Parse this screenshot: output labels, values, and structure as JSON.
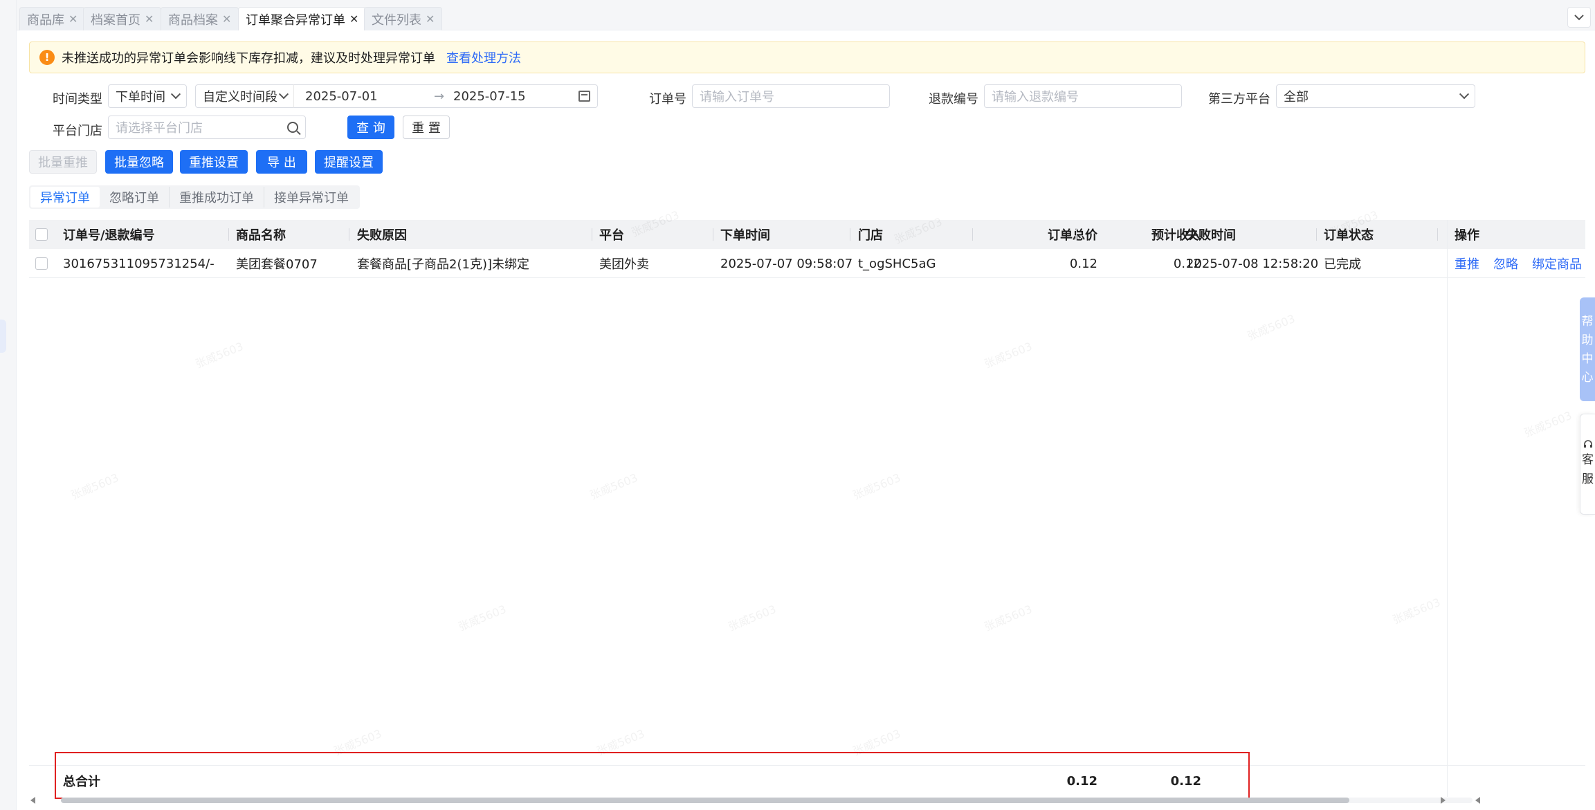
{
  "tabs": [
    {
      "label": "商品库",
      "active": false
    },
    {
      "label": "档案首页",
      "active": false
    },
    {
      "label": "商品档案",
      "active": false
    },
    {
      "label": "订单聚合异常订单",
      "active": true
    },
    {
      "label": "文件列表",
      "active": false
    }
  ],
  "tab_close_glyph": "✕",
  "alert": {
    "message": "未推送成功的异常订单会影响线下库存扣减，建议及时处理异常订单",
    "link": "查看处理方法",
    "icon": "warning-icon"
  },
  "filters": {
    "time_type_label": "时间类型",
    "time_type_value": "下单时间",
    "time_range_mode": "自定义时间段",
    "date_start": "2025-07-01",
    "date_arrow": "→",
    "date_end": "2025-07-15",
    "order_no_label": "订单号",
    "order_no_placeholder": "请输入订单号",
    "refund_no_label": "退款编号",
    "refund_no_placeholder": "请输入退款编号",
    "platform_label": "第三方平台",
    "platform_value": "全部",
    "store_label": "平台门店",
    "store_placeholder": "请选择平台门店",
    "query_button": "查 询",
    "reset_button": "重 置"
  },
  "actions": {
    "batch_repush": "批量重推",
    "batch_ignore": "批量忽略",
    "repush_settings": "重推设置",
    "export": "导 出",
    "reminder_settings": "提醒设置"
  },
  "subtabs": [
    {
      "label": "异常订单",
      "active": true
    },
    {
      "label": "忽略订单",
      "active": false
    },
    {
      "label": "重推成功订单",
      "active": false
    },
    {
      "label": "接单异常订单",
      "active": false
    }
  ],
  "table": {
    "columns": [
      "订单号/退款编号",
      "商品名称",
      "失败原因",
      "平台",
      "下单时间",
      "门店",
      "订单总价",
      "预计收入",
      "失败时间",
      "订单状态",
      "操作"
    ],
    "rows": [
      {
        "order_no": "301675311095731254/-",
        "product": "美团套餐0707",
        "reason": "套餐商品[子商品2(1克)]未绑定",
        "platform": "美团外卖",
        "order_time": "2025-07-07 09:58:07",
        "store": "t_ogSHC5aG",
        "total": "0.12",
        "income": "0.12",
        "fail_time": "2025-07-08 12:58:20",
        "status": "已完成",
        "ops": [
          "重推",
          "忽略",
          "绑定商品"
        ]
      }
    ],
    "summary": {
      "label": "总合计",
      "total": "0.12",
      "income": "0.12"
    }
  },
  "side_widgets": {
    "help": [
      "帮",
      "助",
      "中",
      "心"
    ],
    "service": [
      "客",
      "服"
    ]
  },
  "watermark": "张威5603"
}
